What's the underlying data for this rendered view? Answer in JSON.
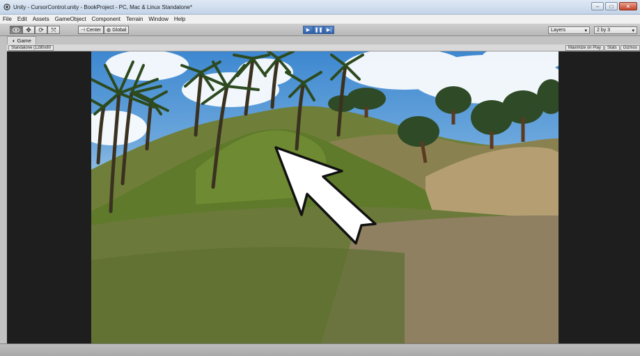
{
  "window": {
    "title": "Unity - CursorControl.unity - BookProject - PC, Mac & Linux Standalone*",
    "controls": [
      "minimize-icon",
      "maximize-icon",
      "close-icon"
    ]
  },
  "menu": [
    "File",
    "Edit",
    "Assets",
    "GameObject",
    "Component",
    "Terrain",
    "Window",
    "Help"
  ],
  "toolbar": {
    "tools": [
      "hand-icon",
      "move-icon",
      "rotate-icon",
      "scale-icon"
    ],
    "pivot_label": "Center",
    "space_label": "Global",
    "playback": [
      "play-icon",
      "pause-icon",
      "step-icon"
    ],
    "layers_label": "Layers",
    "layout_label": "2 by 3"
  },
  "game_tab": {
    "label": "Game",
    "resolution": "Standalone (1280x80",
    "maximize_label": "Maximize on Play",
    "stats_label": "Stats",
    "gizmos_label": "Gizmos"
  },
  "scene": {
    "cursor": "arrow-cursor-icon",
    "accent": "#2c5fae"
  }
}
